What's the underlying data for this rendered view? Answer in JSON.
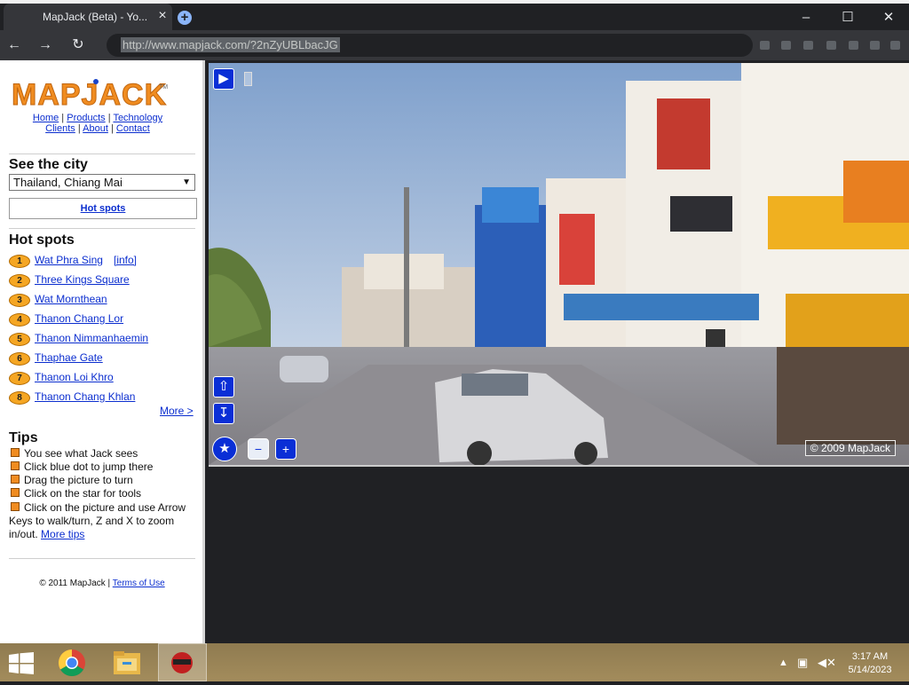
{
  "browser": {
    "tab_title": "MapJack (Beta) - Yo...",
    "url": "http://www.mapjack.com/?2nZyUBLbacJG"
  },
  "site": {
    "logo_text": "MAPJACK",
    "logo_tm": "TM",
    "nav_row1": [
      "Home",
      "Products",
      "Technology"
    ],
    "nav_row2": [
      "Clients",
      "About",
      "Contact"
    ],
    "see_city_heading": "See the city",
    "city_selected": "Thailand, Chiang Mai",
    "hot_spots_button": "Hot spots",
    "hot_spots_heading": "Hot spots",
    "hot_spots": [
      {
        "num": "1",
        "name": "Wat Phra Sing"
      },
      {
        "num": "2",
        "name": "Three Kings Square"
      },
      {
        "num": "3",
        "name": "Wat Mornthean"
      },
      {
        "num": "4",
        "name": "Thanon Chang Lor"
      },
      {
        "num": "5",
        "name": "Thanon Nimmanhaemin"
      },
      {
        "num": "6",
        "name": "Thaphae Gate"
      },
      {
        "num": "7",
        "name": "Thanon Loi Khro"
      },
      {
        "num": "8",
        "name": "Thanon Chang Khlan"
      }
    ],
    "info_link": "[info]",
    "more_link": "More >",
    "tips_heading": "Tips",
    "tips": [
      "You see what Jack sees",
      "Click blue dot to jump there",
      "Drag the picture to turn",
      "Click on the star for tools"
    ],
    "tip_last": "Click on the picture and use Arrow Keys to walk/turn, Z and X to zoom in/out.",
    "more_tips": "More tips",
    "footer_text": "© 2011 MapJack |",
    "terms_link": "Terms of Use",
    "viewer_copyright": "© 2009 MapJack"
  },
  "taskbar": {
    "time": "3:17 AM",
    "date": "5/14/2023"
  }
}
